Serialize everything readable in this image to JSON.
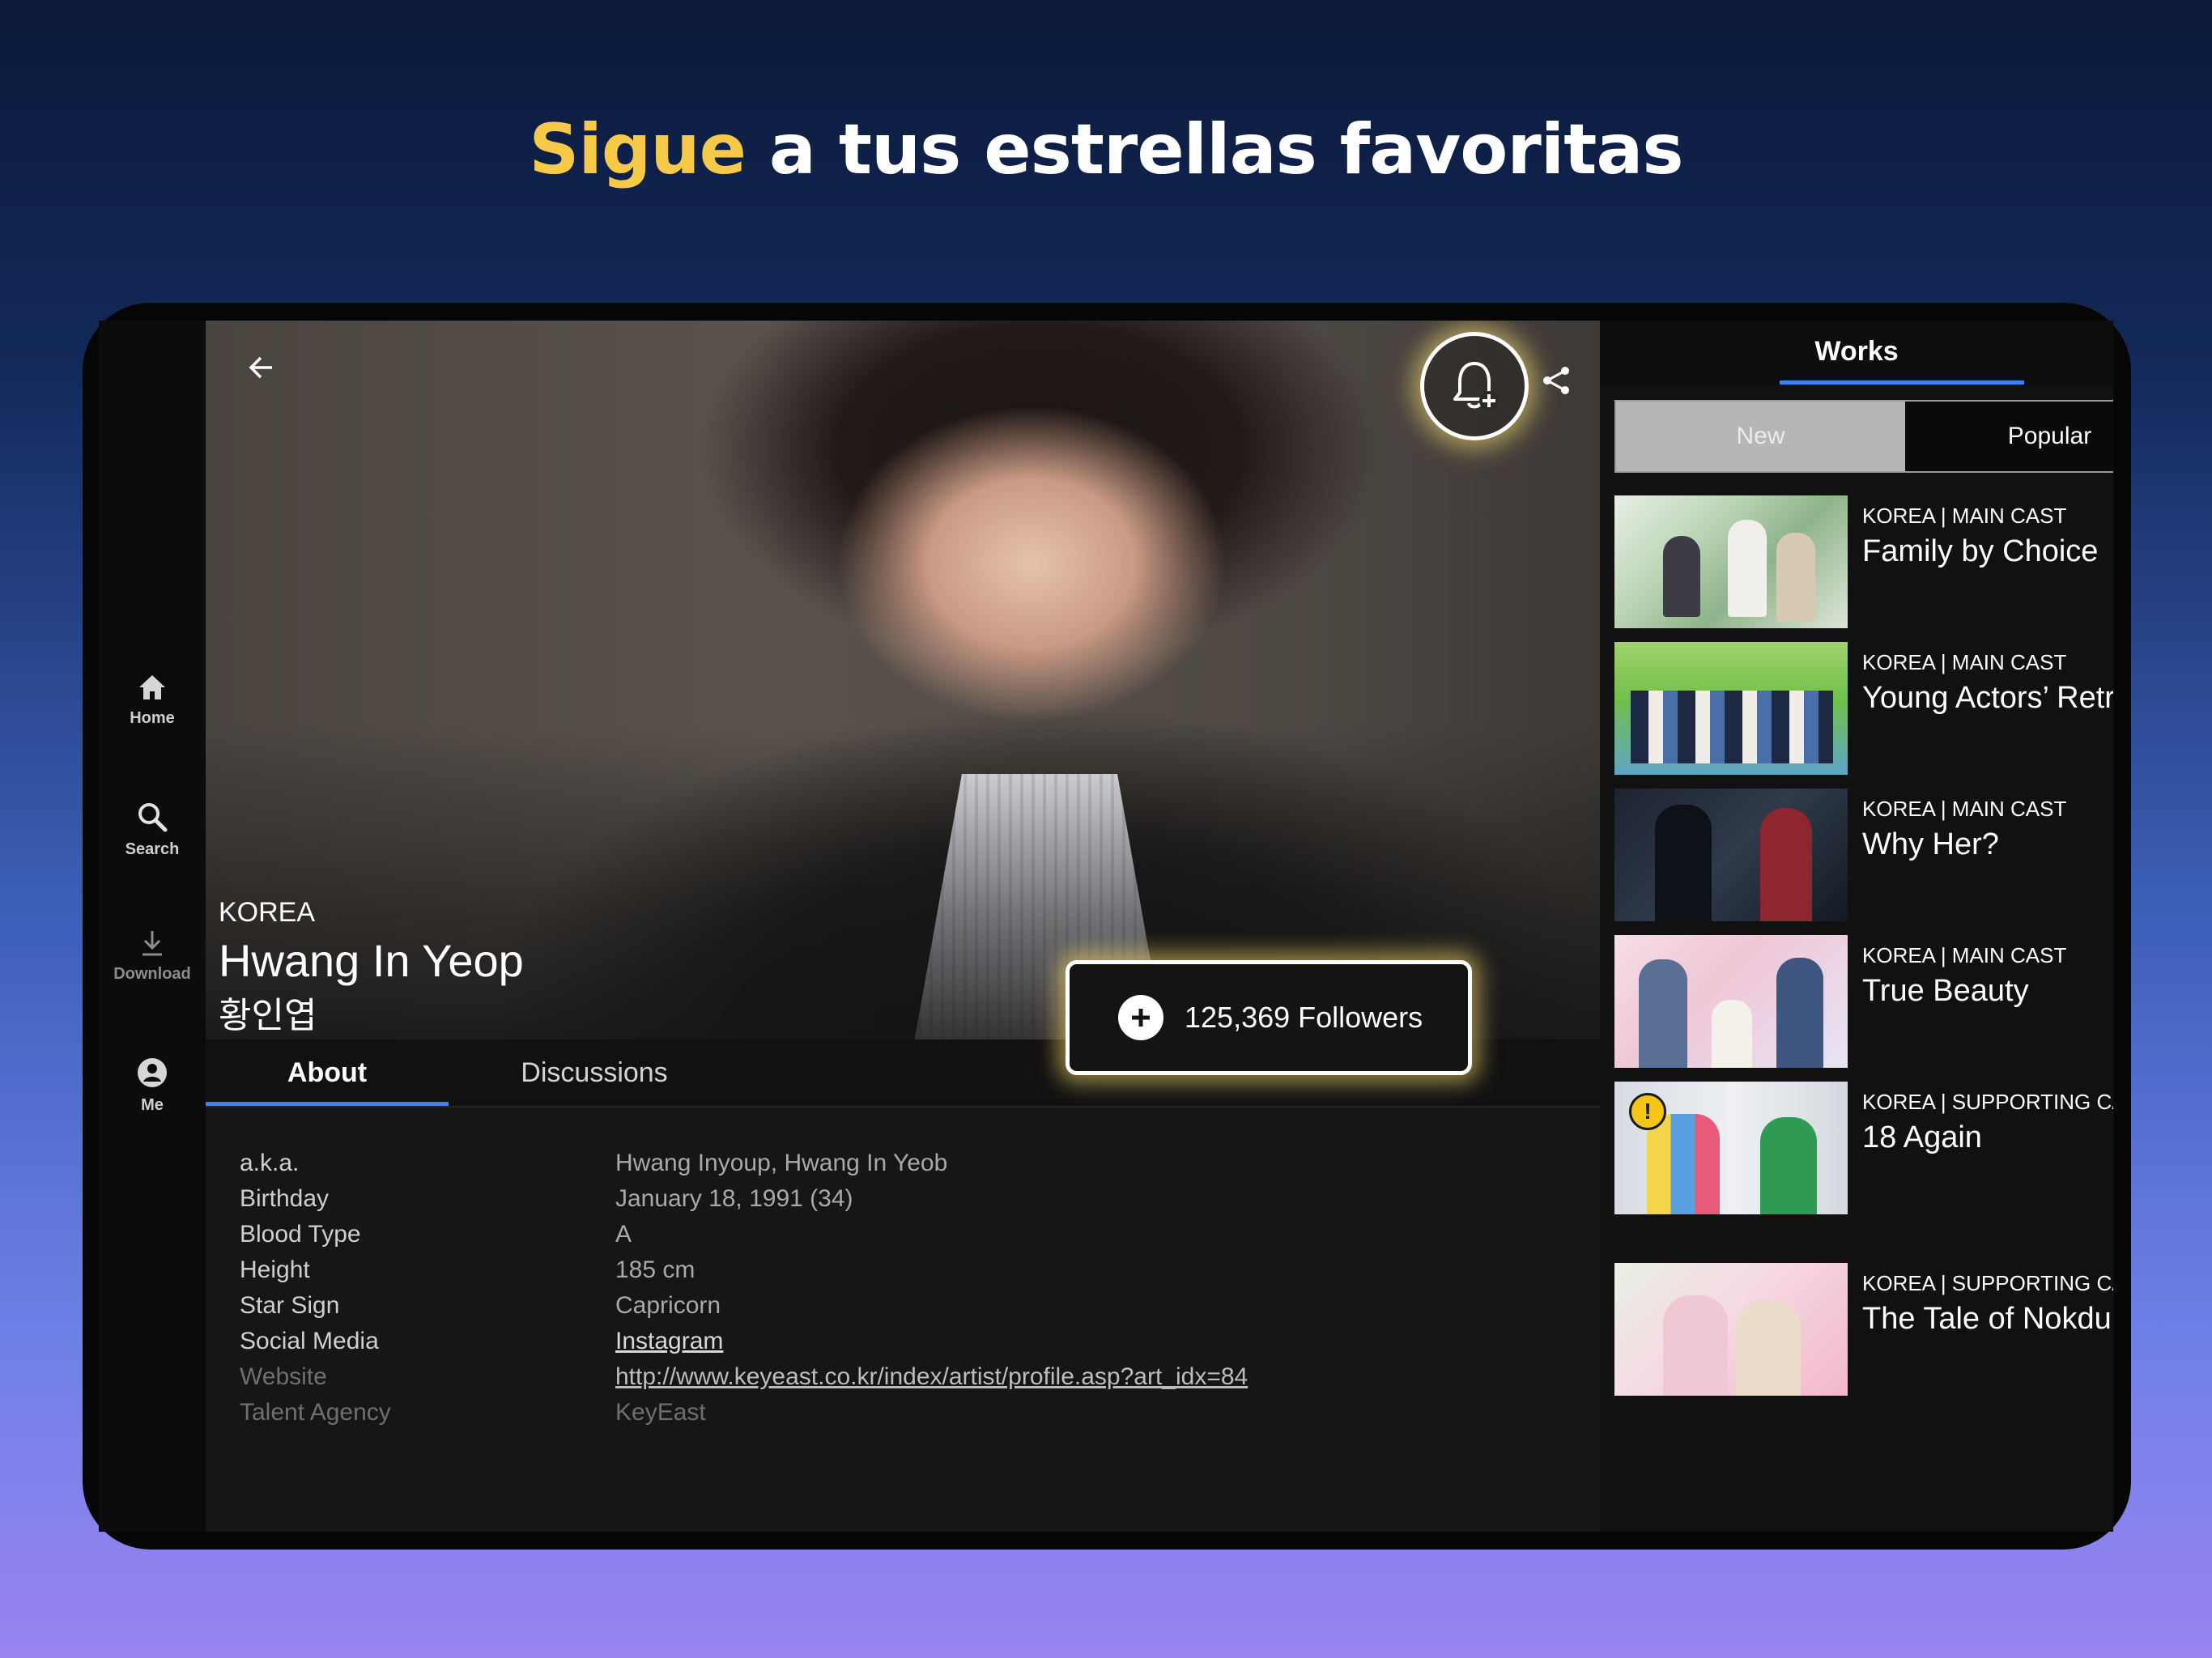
{
  "headline": {
    "accent": "Sigue",
    "rest": " a tus estrellas favoritas"
  },
  "nav": {
    "home": "Home",
    "search": "Search",
    "download": "Download",
    "me": "Me"
  },
  "profile": {
    "country": "KOREA",
    "name": "Hwang In Yeop",
    "native_name": "황인엽",
    "followers": "125,369 Followers"
  },
  "tabs": {
    "about": "About",
    "discussions": "Discussions"
  },
  "details": [
    {
      "label": "a.k.a.",
      "value": "Hwang Inyoup, Hwang In Yeob"
    },
    {
      "label": "Birthday",
      "value": "January 18, 1991 (34)"
    },
    {
      "label": "Blood Type",
      "value": "A"
    },
    {
      "label": "Height",
      "value": "185 cm"
    },
    {
      "label": "Star Sign",
      "value": "Capricorn"
    },
    {
      "label": "Social Media",
      "value": "Instagram"
    },
    {
      "label": "Website",
      "value": "http://www.keyeast.co.kr/index/artist/profile.asp?art_idx=84"
    },
    {
      "label": "Talent Agency",
      "value": "KeyEast"
    }
  ],
  "works": {
    "title": "Works",
    "filter_new": "New",
    "filter_popular": "Popular",
    "items": [
      {
        "meta": "KOREA | MAIN CAST",
        "title": "Family by Choice"
      },
      {
        "meta": "KOREA | MAIN CAST",
        "title": "Young Actors’ Retreat"
      },
      {
        "meta": "KOREA | MAIN CAST",
        "title": "Why Her?"
      },
      {
        "meta": "KOREA | MAIN CAST",
        "title": "True Beauty"
      },
      {
        "meta": "KOREA | SUPPORTING CAST",
        "title": "18 Again",
        "badge": "!"
      },
      {
        "meta": "KOREA | SUPPORTING CAST",
        "title": "The Tale of Nokdu"
      }
    ]
  },
  "colors": {
    "accent": "#f7c948",
    "tab_indicator": "#3b82f6",
    "glow": "#ffe16e"
  }
}
